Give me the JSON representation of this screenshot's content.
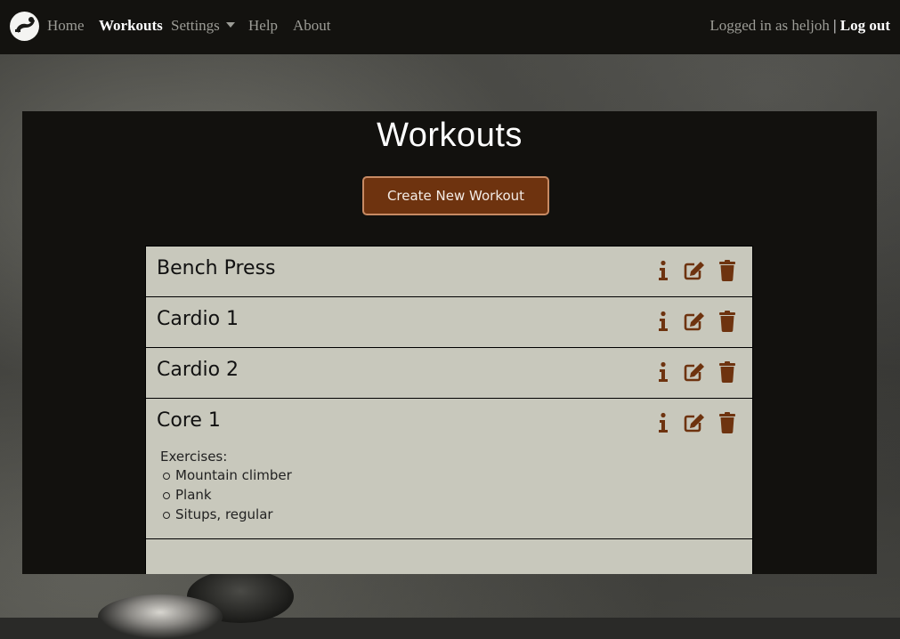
{
  "nav": {
    "items": [
      {
        "label": "Home",
        "active": false
      },
      {
        "label": "Workouts",
        "active": true
      },
      {
        "label": "Settings",
        "active": false,
        "dropdown": true
      },
      {
        "label": "Help",
        "active": false
      },
      {
        "label": "About",
        "active": false
      }
    ],
    "logged_in_text": "Logged in as heljoh",
    "separator": "|",
    "logout_label": "Log out"
  },
  "page": {
    "title": "Workouts",
    "create_button_label": "Create New Workout"
  },
  "workouts": [
    {
      "name": "Bench Press",
      "expanded": false
    },
    {
      "name": "Cardio 1",
      "expanded": false
    },
    {
      "name": "Cardio 2",
      "expanded": false
    },
    {
      "name": "Core 1",
      "expanded": true,
      "details_label": "Exercises:",
      "exercises": [
        "Mountain climber",
        "Plank",
        "Situps, regular"
      ]
    }
  ],
  "icons": [
    "info-icon",
    "edit-icon",
    "trash-icon"
  ],
  "colors": {
    "navbar": "#13120f",
    "panel": "#12110e",
    "row_background": "#c8c8bc",
    "accent_brown": "#6e330f",
    "button_border": "#c78a63"
  }
}
